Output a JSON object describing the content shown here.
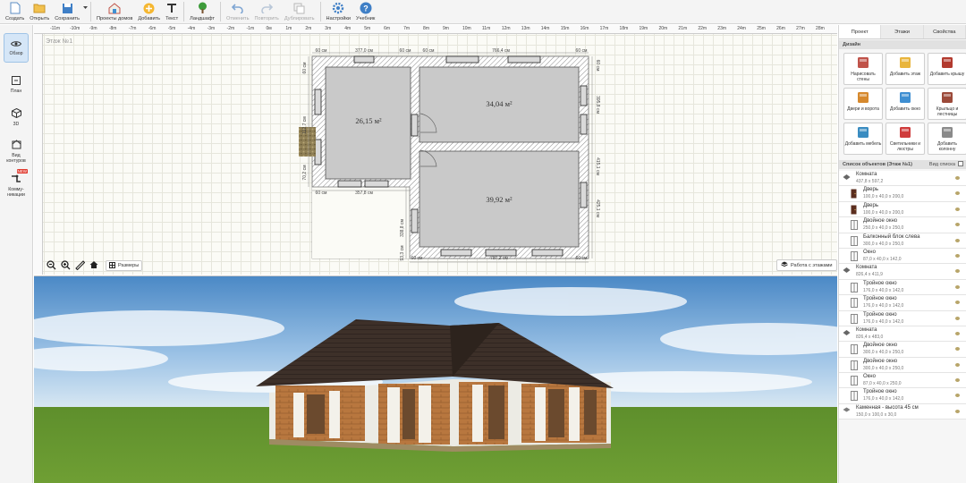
{
  "toolbar": {
    "create": "Создать",
    "open": "Открыть",
    "save": "Сохранить",
    "projects": "Проекты домов",
    "add": "Добавить",
    "text": "Текст",
    "landscape": "Ландшафт",
    "undo": "Отменить",
    "redo": "Повторить",
    "duplicate": "Дублировать",
    "settings": "Настройки",
    "tutorial": "Учебник"
  },
  "leftnav": {
    "overview": "Обзор",
    "plan": "План",
    "view3d": "3D",
    "contours": "Вид контуров",
    "communications": "Комму-никации",
    "new_badge": "NEW"
  },
  "plan": {
    "floor_label": "Этаж №1",
    "ruler_ticks": [
      "-11m",
      "-10m",
      "-9m",
      "-8m",
      "-7m",
      "-6m",
      "-5m",
      "-4m",
      "-3m",
      "-2m",
      "-1m",
      "0м",
      "1m",
      "2m",
      "3m",
      "4m",
      "5m",
      "6m",
      "7m",
      "8m",
      "9m",
      "10m",
      "11m",
      "12m",
      "13m",
      "14m",
      "15m",
      "16m",
      "17m",
      "18m",
      "19m",
      "20m",
      "21m",
      "22m",
      "23m",
      "24m",
      "25m",
      "26m",
      "27m",
      "28m"
    ],
    "room_areas": [
      "26,15 м²",
      "34,04 м²",
      "39,92 м²"
    ],
    "dimensions": [
      "377,0 см",
      "60 см",
      "60 см",
      "766,4 см",
      "60 см",
      "60 см",
      "357,8 см",
      "60 см",
      "787,2 см",
      "60 см",
      "60 см",
      "395,8 см",
      "415,1 см",
      "425,1 см",
      "338,8 см",
      "93,3 см",
      "70,2 см",
      "60 см",
      "112,7 см",
      "60 см"
    ],
    "tools": {
      "dims_label": "Размеры",
      "floors_label": "Работа с этажами"
    }
  },
  "rightpanel": {
    "tabs": [
      "Проект",
      "Этажи",
      "Свойства"
    ],
    "design_header": "Дизайн",
    "design_tiles": [
      {
        "label": "Нарисовать стены",
        "color": "#c0534a"
      },
      {
        "label": "Добавить этаж",
        "color": "#e9b53c"
      },
      {
        "label": "Добавить крышу",
        "color": "#b23a2e"
      },
      {
        "label": "Двери и ворота",
        "color": "#d6892e"
      },
      {
        "label": "Добавить окно",
        "color": "#3f8fd2"
      },
      {
        "label": "Крыльцо и лестницы",
        "color": "#9c4a3a"
      },
      {
        "label": "Добавить мебель",
        "color": "#3a8cc1"
      },
      {
        "label": "Светильники и люстры",
        "color": "#cf3b3b"
      },
      {
        "label": "Добавить колонну",
        "color": "#8a8a8a"
      }
    ],
    "objlist_header": "Список объектов (Этаж №1)",
    "objlist_view": "Вид списка",
    "objects": [
      {
        "name": "Комната",
        "size": "437,8 x 597,2",
        "level": 0,
        "kind": "room"
      },
      {
        "name": "Дверь",
        "size": "100,0 x 40,0 x 200,0",
        "level": 1,
        "kind": "door"
      },
      {
        "name": "Дверь",
        "size": "100,0 x 40,0 x 200,0",
        "level": 1,
        "kind": "door"
      },
      {
        "name": "Двойное окно",
        "size": "250,0 x 40,0 x 250,0",
        "level": 1,
        "kind": "window"
      },
      {
        "name": "Балконный блок слева",
        "size": "300,0 x 40,0 x 250,0",
        "level": 1,
        "kind": "window"
      },
      {
        "name": "Окно",
        "size": "87,0 x 40,0 x 142,0",
        "level": 1,
        "kind": "window"
      },
      {
        "name": "Комната",
        "size": "826,4 x 411,9",
        "level": 0,
        "kind": "room"
      },
      {
        "name": "Тройное окно",
        "size": "176,0 x 40,0 x 142,0",
        "level": 1,
        "kind": "window"
      },
      {
        "name": "Тройное окно",
        "size": "176,0 x 40,0 x 142,0",
        "level": 1,
        "kind": "window"
      },
      {
        "name": "Тройное окно",
        "size": "176,0 x 40,0 x 142,0",
        "level": 1,
        "kind": "window"
      },
      {
        "name": "Комната",
        "size": "826,4 x 483,0",
        "level": 0,
        "kind": "room"
      },
      {
        "name": "Двойное окно",
        "size": "300,0 x 40,0 x 250,0",
        "level": 1,
        "kind": "window"
      },
      {
        "name": "Двойное окно",
        "size": "300,0 x 40,0 x 250,0",
        "level": 1,
        "kind": "window"
      },
      {
        "name": "Окно",
        "size": "87,0 x 40,0 x 250,0",
        "level": 1,
        "kind": "window"
      },
      {
        "name": "Тройное окно",
        "size": "176,0 x 40,0 x 142,0",
        "level": 1,
        "kind": "window"
      },
      {
        "name": "Каменная - высота 45 см",
        "size": "150,0 x 100,0 x 30,0",
        "level": 0,
        "kind": "stone"
      }
    ]
  }
}
